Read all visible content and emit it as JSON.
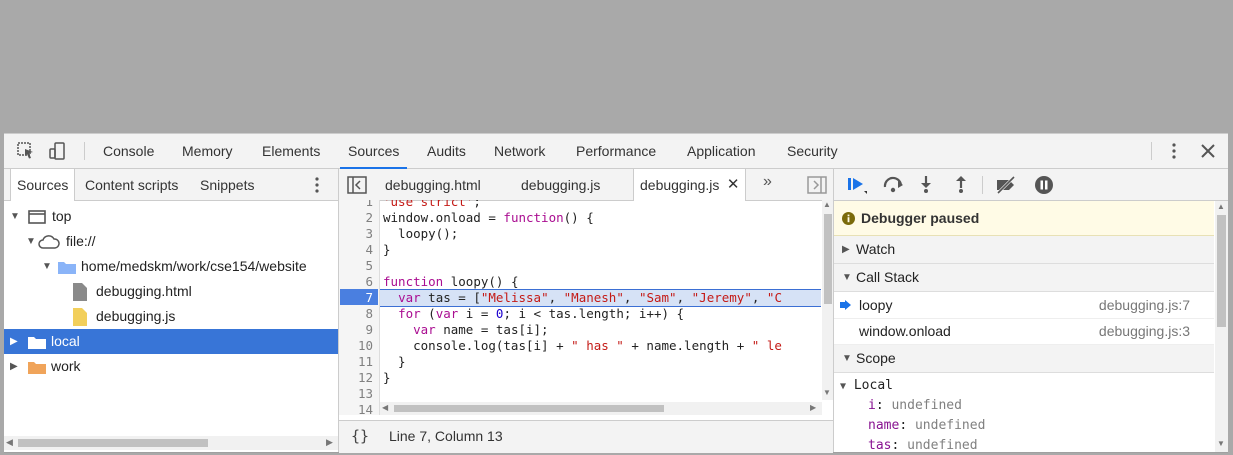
{
  "toolbar": {
    "tabs": [
      "Console",
      "Memory",
      "Elements",
      "Sources",
      "Audits",
      "Network",
      "Performance",
      "Application",
      "Security"
    ]
  },
  "navigator": {
    "tabs": [
      "Sources",
      "Content scripts",
      "Snippets"
    ],
    "tree": [
      {
        "label": "top"
      },
      {
        "label": "file://"
      },
      {
        "label": "home/medskm/work/cse154/website"
      },
      {
        "label": "debugging.html"
      },
      {
        "label": "debugging.js"
      },
      {
        "label": "local"
      },
      {
        "label": "work"
      }
    ]
  },
  "editor": {
    "tabs": [
      "debugging.html",
      "debugging.js",
      "debugging.js"
    ],
    "lines": [
      {
        "n": "1",
        "text": "'use strict';"
      },
      {
        "n": "2",
        "text": "window.onload = function() {"
      },
      {
        "n": "3",
        "text": "  loopy();"
      },
      {
        "n": "4",
        "text": "}"
      },
      {
        "n": "5",
        "text": ""
      },
      {
        "n": "6",
        "text": "function loopy() {"
      },
      {
        "n": "7",
        "text": "  var tas = [\"Melissa\", \"Manesh\", \"Sam\", \"Jeremy\", \"C"
      },
      {
        "n": "8",
        "text": "  for (var i = 0; i < tas.length; i++) {"
      },
      {
        "n": "9",
        "text": "    var name = tas[i];"
      },
      {
        "n": "10",
        "text": "    console.log(tas[i] + \" has \" + name.length + \" le"
      },
      {
        "n": "11",
        "text": "  }"
      },
      {
        "n": "12",
        "text": "}"
      },
      {
        "n": "13",
        "text": ""
      },
      {
        "n": "14",
        "text": ""
      }
    ],
    "status": "Line 7, Column 13",
    "format_label": "{}"
  },
  "debugger": {
    "paused": "Debugger paused",
    "watch": "Watch",
    "call_stack": "Call Stack",
    "frames": [
      {
        "name": "loopy",
        "loc": "debugging.js:7"
      },
      {
        "name": "window.onload",
        "loc": "debugging.js:3"
      }
    ],
    "scope": "Scope",
    "local": "Local",
    "vars": [
      {
        "name": "i",
        "value": "undefined"
      },
      {
        "name": "name",
        "value": "undefined"
      },
      {
        "name": "tas",
        "value": "undefined"
      }
    ]
  },
  "colors": {
    "accent": "#1a73e8",
    "selection": "#3875d7",
    "exec_line": "#3b6fd4"
  }
}
